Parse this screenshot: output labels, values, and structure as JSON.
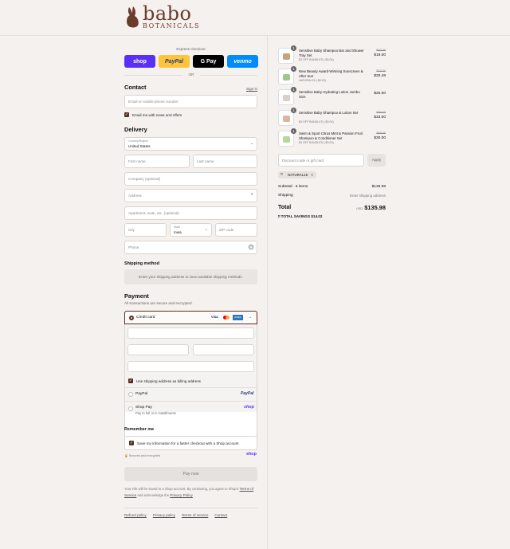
{
  "brand": {
    "name": "babo",
    "sub": "BOTANICALS"
  },
  "express": {
    "label": "Express checkout",
    "or": "OR",
    "shop": "shop",
    "paypal": "PayPal",
    "gpay": "G Pay",
    "venmo": "venmo"
  },
  "contact": {
    "heading": "Contact",
    "signin": "Sign in",
    "placeholder": "Email or mobile phone number",
    "news": "Email me with news and offers"
  },
  "delivery": {
    "heading": "Delivery",
    "country_label": "Country/Region",
    "country_value": "United States",
    "first": "First name",
    "last": "Last name",
    "company": "Company (optional)",
    "address": "Address",
    "apt": "Apartment, suite, etc. (optional)",
    "city": "City",
    "state_label": "State",
    "state_value": "Iowa",
    "zip": "ZIP code",
    "phone": "Phone"
  },
  "shipping": {
    "heading": "Shipping method",
    "note": "Enter your shipping address to view available shipping methods."
  },
  "payment": {
    "heading": "Payment",
    "sub": "All transactions are secure and encrypted.",
    "credit": "Credit card",
    "billing": "Use shipping address as billing address",
    "paypal": "PayPal",
    "shoppay": "Shop Pay",
    "shoppay_sub": "Pay in full or in installments",
    "visa": "VISA",
    "amex": "AMEX",
    "more": "→"
  },
  "remember": {
    "heading": "Remember me",
    "save": "Save my information for a faster checkout with a Shop account",
    "secure": "Secured and encrypted",
    "shop": "shop"
  },
  "paynow": "Pay now",
  "legal": {
    "text1": "Your info will be saved to a Shop account. By continuing, you agree to Shop's",
    "tos": "Terms of Service",
    "and": "and acknowledge the",
    "privacy": "Privacy Policy",
    "period": "."
  },
  "footer": [
    "Refund policy",
    "Privacy policy",
    "Terms of service",
    "Contact"
  ],
  "items": [
    {
      "qty": "1",
      "name1": "Sensitive Baby Shampoo Bar and Shower",
      "name2": "Tray Set",
      "disc": "$3 OFF BUNDLES (-$3.00)",
      "old": "$22.00",
      "price": "$19.00"
    },
    {
      "qty": "1",
      "name1": "New Beauty Award-Winning Sunscreen &",
      "name2": "After Sun",
      "disc": "NATURAL15 (-$5.02)",
      "old": "$33.50",
      "price": "$28.48"
    },
    {
      "qty": "1",
      "name1": "Sensitive Baby Hydrating Lotion Jumbo",
      "name2": "Size",
      "disc": "",
      "old": "",
      "price": "$25.50"
    },
    {
      "qty": "1",
      "name1": "Sensitive Baby Shampoo & Lotion Set",
      "name2": "",
      "disc": "$3 OFF BUNDLES (-$3.00)",
      "old": "$36.00",
      "price": "$33.00"
    },
    {
      "qty": "1",
      "name1": "Swim & Sport Citrus Mint & Passion Fruit",
      "name2": "Shampoo & Conditioner Set",
      "disc": "$3 OFF BUNDLES (-$3.00)",
      "old": "$33.00",
      "price": "$30.00"
    }
  ],
  "discount": {
    "placeholder": "Discount code or gift card",
    "apply": "Apply",
    "tag": "NATURAL15",
    "x": "×"
  },
  "summary": {
    "subtotal_label": "Subtotal · 5 items",
    "subtotal": "$135.98",
    "shipping_label": "Shipping",
    "shipping": "Enter shipping address",
    "total_label": "Total",
    "currency": "USD",
    "total": "$135.98",
    "savings_label": "TOTAL SAVINGS",
    "savings": "$14.02"
  }
}
